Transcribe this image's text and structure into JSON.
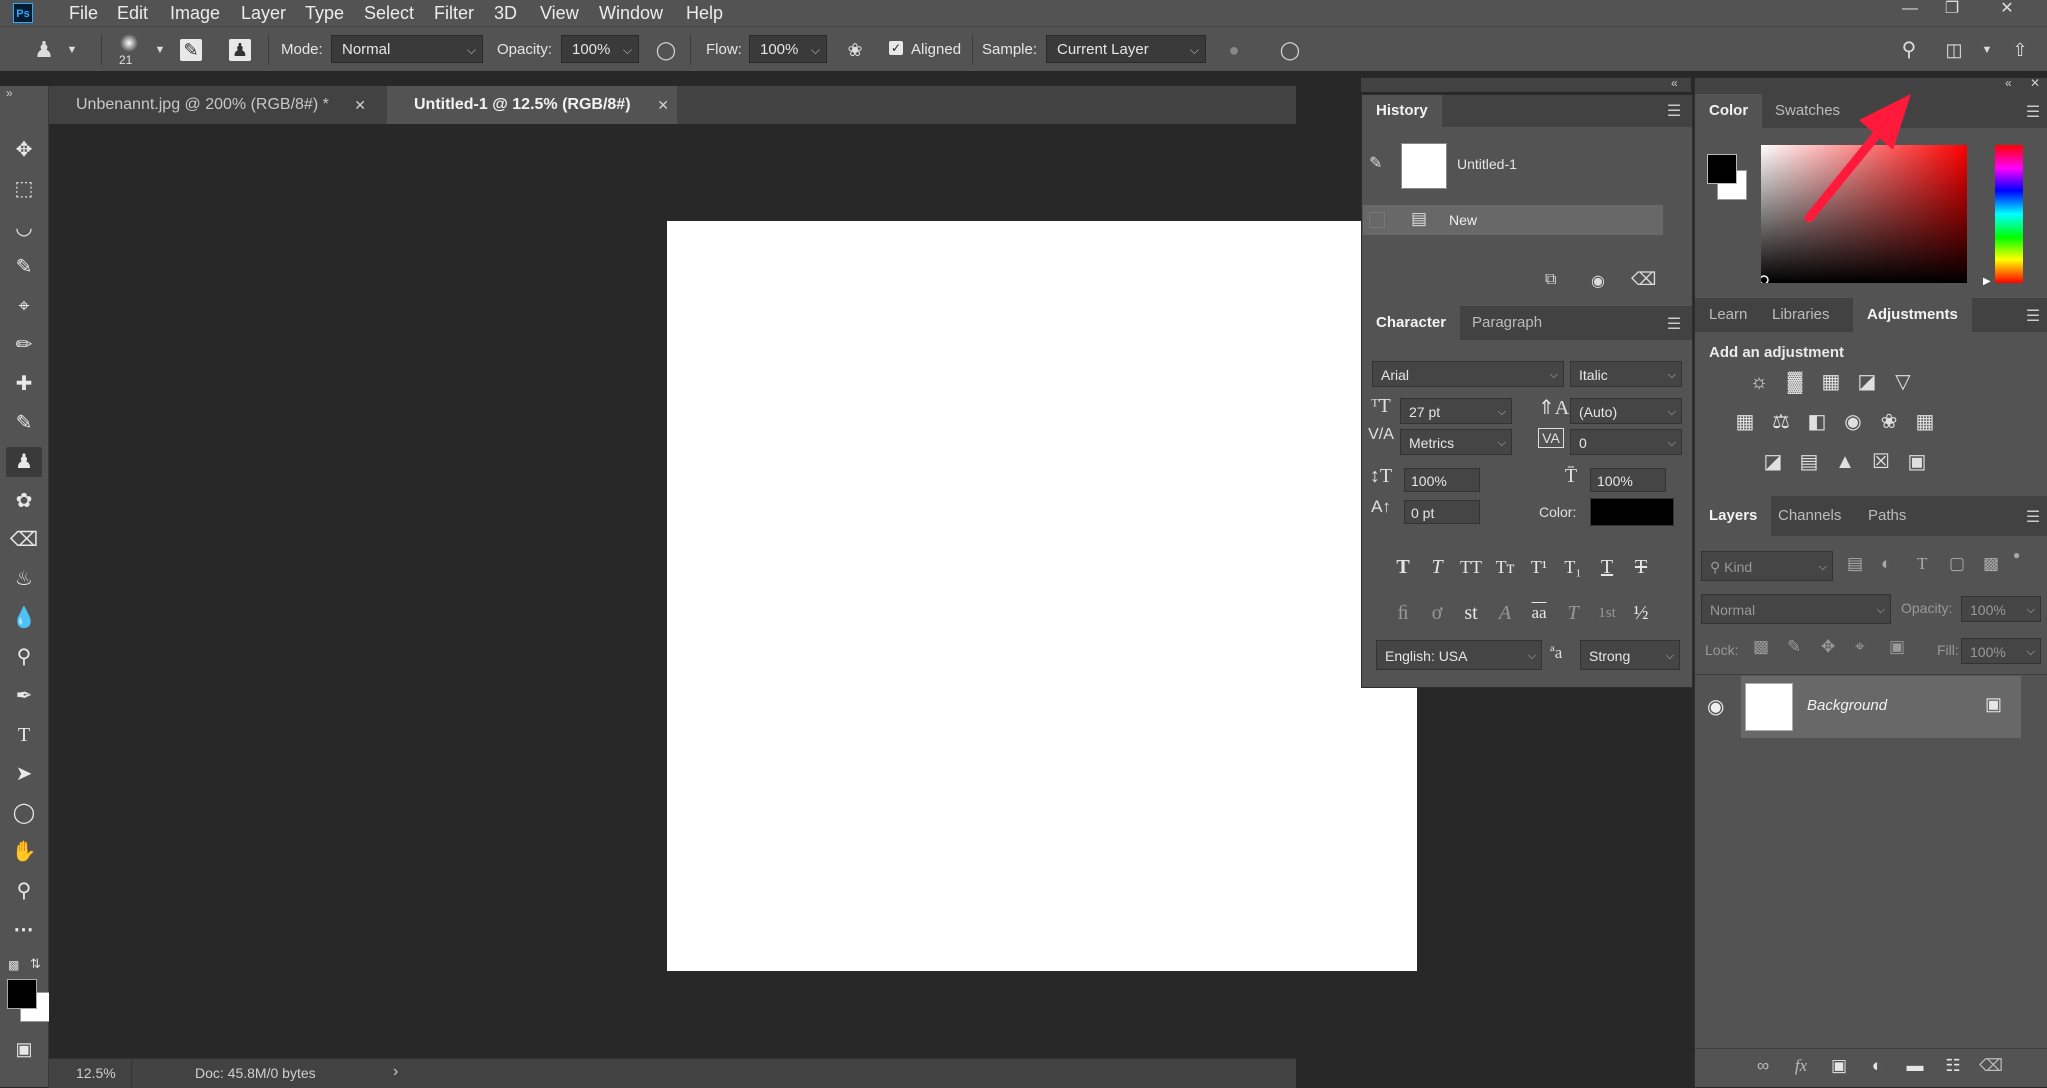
{
  "app": {
    "logo": "Ps"
  },
  "menu": [
    "File",
    "Edit",
    "Image",
    "Layer",
    "Type",
    "Select",
    "Filter",
    "3D",
    "View",
    "Window",
    "Help"
  ],
  "options": {
    "brush_size": "21",
    "mode_label": "Mode:",
    "mode_value": "Normal",
    "opacity_label": "Opacity:",
    "opacity_value": "100%",
    "flow_label": "Flow:",
    "flow_value": "100%",
    "aligned_label": "Aligned",
    "aligned_checked": true,
    "sample_label": "Sample:",
    "sample_value": "Current Layer"
  },
  "tabs": [
    {
      "label": "Unbenannt.jpg @ 200% (RGB/8#) *",
      "active": false
    },
    {
      "label": "Untitled-1 @ 12.5% (RGB/8#)",
      "active": true
    }
  ],
  "status": {
    "zoom": "12.5%",
    "doc": "Doc: 45.8M/0 bytes"
  },
  "history": {
    "tab": "History",
    "snapshot_label": "Untitled-1",
    "state_label": "New"
  },
  "character": {
    "tabs": [
      "Character",
      "Paragraph"
    ],
    "font_family": "Arial",
    "font_style": "Italic",
    "font_size": "27 pt",
    "leading": "(Auto)",
    "kerning": "Metrics",
    "tracking": "0",
    "vertical_scale": "100%",
    "horizontal_scale": "100%",
    "baseline_shift": "0 pt",
    "color_label": "Color:",
    "color_value": "#000000",
    "language": "English: USA",
    "aa_icon_text": "ªa",
    "antialias": "Strong",
    "type_buttons": [
      "T",
      "T",
      "TT",
      "Tт",
      "T¹",
      "T₁",
      "T",
      "T"
    ],
    "opentype_buttons": [
      "ﬁ",
      "ơ",
      "st",
      "A",
      "aa",
      "T",
      "1st",
      "½"
    ]
  },
  "color_panel": {
    "tabs": [
      "Color",
      "Swatches"
    ],
    "foreground": "#000000",
    "background": "#ffffff"
  },
  "adjustments": {
    "tabs": [
      "Learn",
      "Libraries",
      "Adjustments"
    ],
    "title": "Add an adjustment"
  },
  "layers": {
    "tabs": [
      "Layers",
      "Channels",
      "Paths"
    ],
    "filter_placeholder": "Kind",
    "blend_mode": "Normal",
    "opacity_label": "Opacity:",
    "opacity_value": "100%",
    "lock_label": "Lock:",
    "fill_label": "Fill:",
    "fill_value": "100%",
    "items": [
      {
        "name": "Background",
        "visible": true,
        "locked": true
      }
    ]
  },
  "colors": {
    "accent_arrow": "#ff1a3c",
    "foreground": "#000000",
    "background": "#ffffff"
  }
}
